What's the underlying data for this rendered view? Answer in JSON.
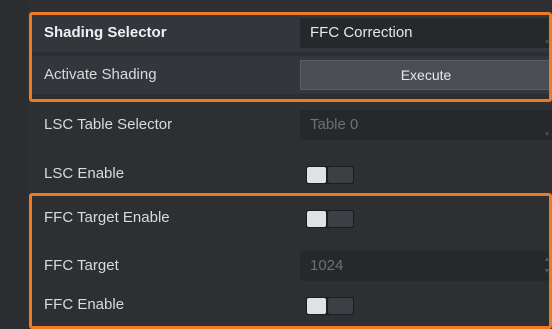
{
  "properties": [
    {
      "label": "Shading Selector",
      "type": "select",
      "value": "FFC Correction"
    },
    {
      "label": "Activate Shading",
      "type": "button",
      "button_label": "Execute"
    },
    {
      "label": "LSC Table Selector",
      "type": "select",
      "value": "Table 0",
      "disabled": true
    },
    {
      "label": "LSC Enable",
      "type": "toggle",
      "checked": false
    },
    {
      "label": "FFC Target Enable",
      "type": "toggle",
      "checked": false
    },
    {
      "label": "FFC Target",
      "type": "number",
      "value": "1024",
      "disabled": true
    },
    {
      "label": "FFC Enable",
      "type": "toggle",
      "checked": false
    }
  ],
  "highlight_color": "#f07a1f"
}
